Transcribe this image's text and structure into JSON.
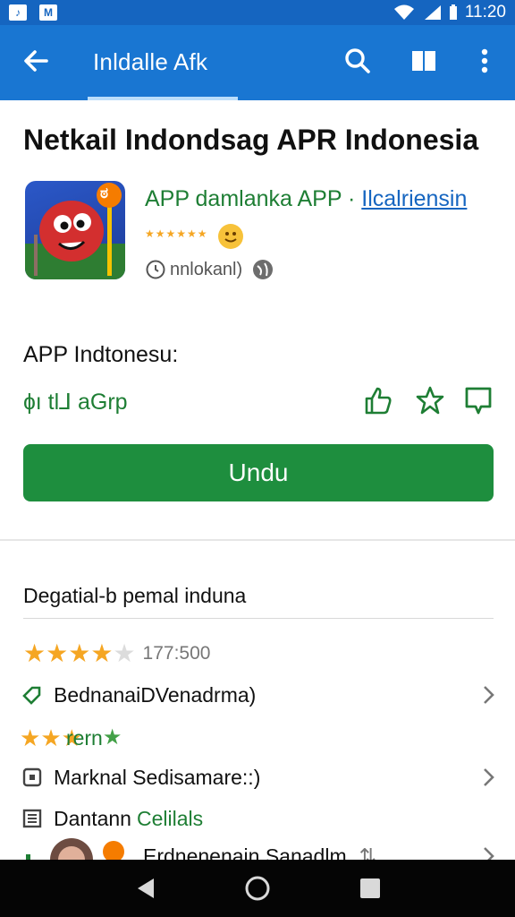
{
  "status_bar": {
    "time": "11:20"
  },
  "app_bar": {
    "title": "Inldalle Afk"
  },
  "app": {
    "title": "Netkail Indondsag APR Indonesia",
    "developer": "APP damlanka APP ·",
    "developer_link": "Ilcalriensin",
    "stars": "★★★★★★",
    "installs": "nnlokanl)",
    "icon_label": "ಠ"
  },
  "price_section": {
    "label": "APP Indtonesu:",
    "price": "ɸı tl⅃ aGrp"
  },
  "download_button": "Undu",
  "details": {
    "title": "Degatial-b pemal induna",
    "rating_count": "177:500",
    "rows": [
      {
        "label": "BednanaiDVenadrma)"
      },
      {
        "label": "rern"
      },
      {
        "label": "Marknal Sedisamare::)"
      },
      {
        "label": "Dantann",
        "label_green": "Celilals"
      },
      {
        "label": "Erdnenenain Sanadlm"
      }
    ]
  },
  "colors": {
    "app_bar": "#1976d2",
    "status_bar": "#1565c0",
    "download": "#1e8e3e",
    "accent_green": "#1e7e34",
    "star": "#f5a623"
  }
}
